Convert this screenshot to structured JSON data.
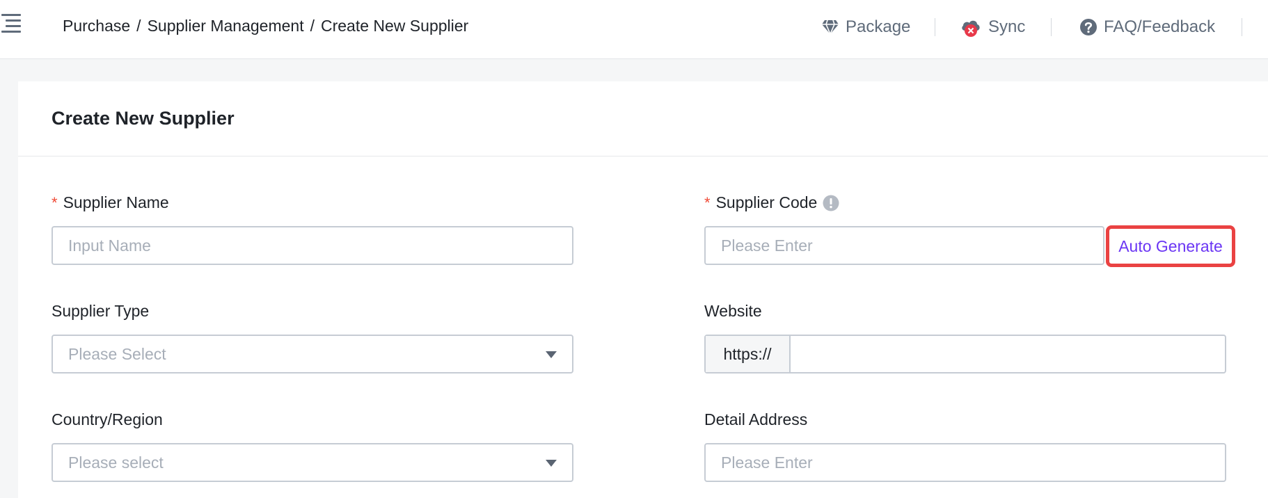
{
  "header": {
    "breadcrumb": [
      "Purchase",
      "Supplier Management",
      "Create New Supplier"
    ],
    "actions": {
      "package": "Package",
      "sync": "Sync",
      "faq": "FAQ/Feedback"
    }
  },
  "form": {
    "title": "Create New Supplier",
    "supplier_name": {
      "label": "Supplier Name",
      "required": "*",
      "placeholder": "Input Name"
    },
    "supplier_code": {
      "label": "Supplier Code",
      "required": "*",
      "placeholder": "Please Enter",
      "auto_generate": "Auto Generate"
    },
    "supplier_type": {
      "label": "Supplier Type",
      "placeholder": "Please Select"
    },
    "website": {
      "label": "Website",
      "prefix": "https://",
      "value": ""
    },
    "country_region": {
      "label": "Country/Region",
      "placeholder": "Please select"
    },
    "detail_address": {
      "label": "Detail Address",
      "placeholder": "Please Enter"
    }
  },
  "colors": {
    "required": "#f04a36",
    "link": "#6b36f4",
    "highlight": "#ea4242",
    "sync_error": "#e8394a"
  }
}
